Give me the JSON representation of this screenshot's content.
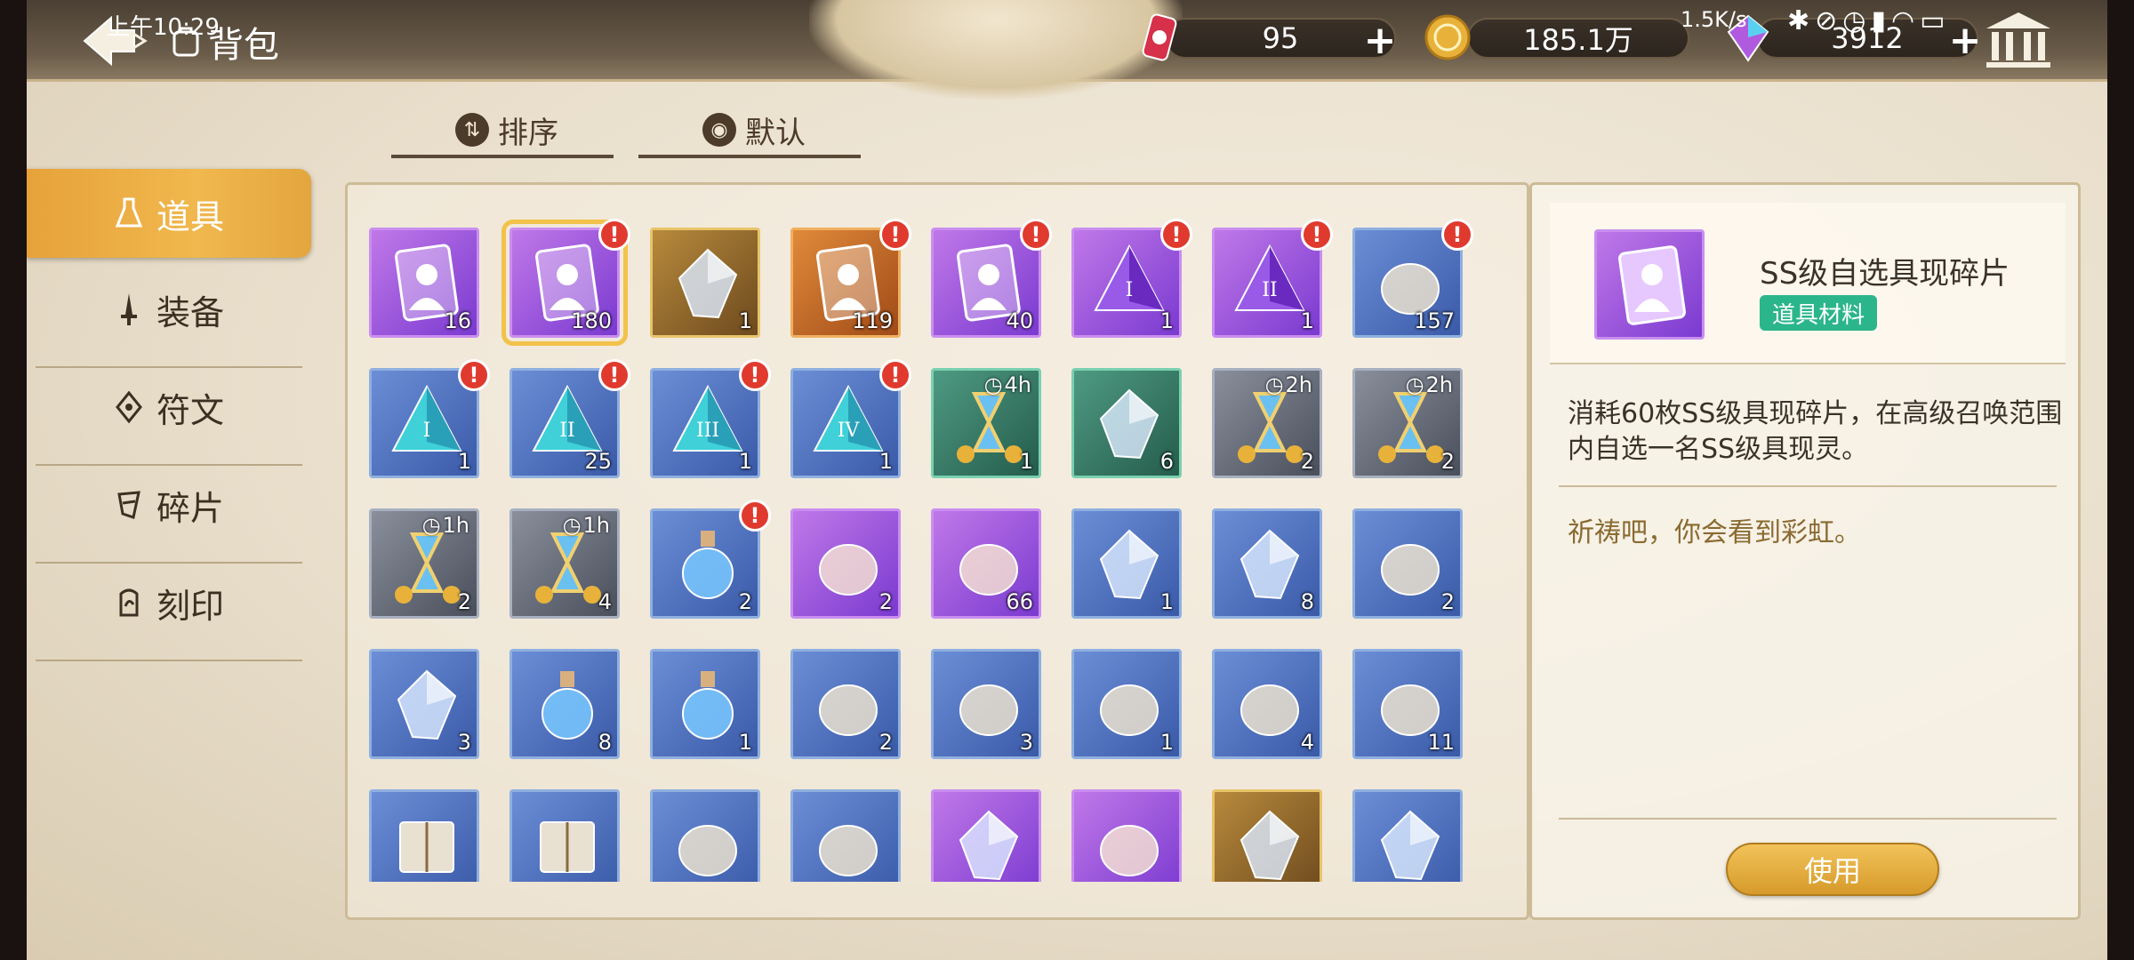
{
  "status_bar": {
    "time": "上午10:29",
    "net_speed": "1.5K/s",
    "icons": [
      "bluetooth-icon",
      "mute-icon",
      "alarm-icon",
      "signal-icon",
      "wifi-icon",
      "battery-icon"
    ]
  },
  "header": {
    "title": "背包",
    "resources": [
      {
        "name": "energy-drink",
        "value": "95"
      },
      {
        "name": "gold-coin",
        "value": "185.1万"
      },
      {
        "name": "rainbow-gem",
        "value": "3912"
      }
    ]
  },
  "sort_bar": {
    "order_label": "排序",
    "default_label": "默认"
  },
  "sidebar": {
    "items": [
      {
        "label": "道具",
        "icon": "flask-icon",
        "active": true
      },
      {
        "label": "装备",
        "icon": "sword-icon",
        "active": false
      },
      {
        "label": "符文",
        "icon": "rune-icon",
        "active": false
      },
      {
        "label": "碎片",
        "icon": "shard-icon",
        "active": false
      },
      {
        "label": "刻印",
        "icon": "seal-icon",
        "active": false
      }
    ]
  },
  "grid": {
    "items": [
      {
        "art": "mystery-card",
        "rarity": "purple",
        "count": "16",
        "badge": false
      },
      {
        "art": "character-card",
        "rarity": "purple",
        "count": "180",
        "badge": true,
        "selected": true
      },
      {
        "art": "gold-crystal",
        "rarity": "gold",
        "count": "1",
        "badge": false
      },
      {
        "art": "orange-mystery-card",
        "rarity": "orange",
        "count": "119",
        "badge": true
      },
      {
        "art": "silhouette-card",
        "rarity": "purple",
        "count": "40",
        "badge": true
      },
      {
        "art": "pyramid-I-purple",
        "rarity": "purple",
        "count": "1",
        "badge": true
      },
      {
        "art": "pyramid-II-purple",
        "rarity": "purple",
        "count": "1",
        "badge": true
      },
      {
        "art": "gift-box",
        "rarity": "blue",
        "count": "157",
        "badge": true
      },
      {
        "art": "pyramid-I-teal",
        "rarity": "blue",
        "count": "1",
        "badge": true
      },
      {
        "art": "pyramid-II-teal",
        "rarity": "blue",
        "count": "25",
        "badge": true
      },
      {
        "art": "pyramid-III-teal",
        "rarity": "blue",
        "count": "1",
        "badge": true
      },
      {
        "art": "pyramid-IV-teal",
        "rarity": "blue",
        "count": "1",
        "badge": true
      },
      {
        "art": "hourglass-coins",
        "rarity": "teal",
        "count": "1",
        "timer": "4h"
      },
      {
        "art": "crystal-tray",
        "rarity": "teal",
        "count": "6"
      },
      {
        "art": "hourglass-coins",
        "rarity": "gray",
        "count": "2",
        "timer": "2h"
      },
      {
        "art": "hourglass-crystal",
        "rarity": "gray",
        "count": "2",
        "timer": "2h"
      },
      {
        "art": "hourglass-coins",
        "rarity": "gray",
        "count": "2",
        "timer": "1h"
      },
      {
        "art": "hourglass-crystal",
        "rarity": "gray",
        "count": "4",
        "timer": "1h"
      },
      {
        "art": "blue-potion",
        "rarity": "blue",
        "count": "2",
        "badge": true
      },
      {
        "art": "rose-bouquet",
        "rarity": "purple",
        "count": "2"
      },
      {
        "art": "robot-egg",
        "rarity": "purple",
        "count": "66"
      },
      {
        "art": "green-crystal",
        "rarity": "blue",
        "count": "1"
      },
      {
        "art": "gray-stone",
        "rarity": "blue",
        "count": "8"
      },
      {
        "art": "leaf",
        "rarity": "blue",
        "count": "2"
      },
      {
        "art": "purple-rock",
        "rarity": "blue",
        "count": "3"
      },
      {
        "art": "orange-flask",
        "rarity": "blue",
        "count": "8"
      },
      {
        "art": "red-flask",
        "rarity": "blue",
        "count": "1"
      },
      {
        "art": "grain-pile",
        "rarity": "blue",
        "count": "2"
      },
      {
        "art": "blue-cloth",
        "rarity": "blue",
        "count": "3"
      },
      {
        "art": "bread-rolls",
        "rarity": "blue",
        "count": "1"
      },
      {
        "art": "umbrella",
        "rarity": "blue",
        "count": "4"
      },
      {
        "art": "lighter",
        "rarity": "blue",
        "count": "11"
      },
      {
        "art": "open-book",
        "rarity": "blue",
        "count": ""
      },
      {
        "art": "dark-book",
        "rarity": "blue",
        "count": ""
      },
      {
        "art": "milk-carton",
        "rarity": "blue",
        "count": ""
      },
      {
        "art": "medal",
        "rarity": "blue",
        "count": ""
      },
      {
        "art": "blue-gem",
        "rarity": "purple",
        "count": ""
      },
      {
        "art": "token-chip",
        "rarity": "purple",
        "count": ""
      },
      {
        "art": "purple-ore",
        "rarity": "gold",
        "count": ""
      },
      {
        "art": "ice-crystal",
        "rarity": "blue",
        "count": ""
      }
    ]
  },
  "detail": {
    "name": "SS级自选具现碎片",
    "tag": "道具材料",
    "description": "消耗60枚SS级具现碎片，在高级召唤范围内自选一名SS级具现灵。",
    "flavor": "祈祷吧，你会看到彩虹。",
    "use_label": "使用"
  }
}
